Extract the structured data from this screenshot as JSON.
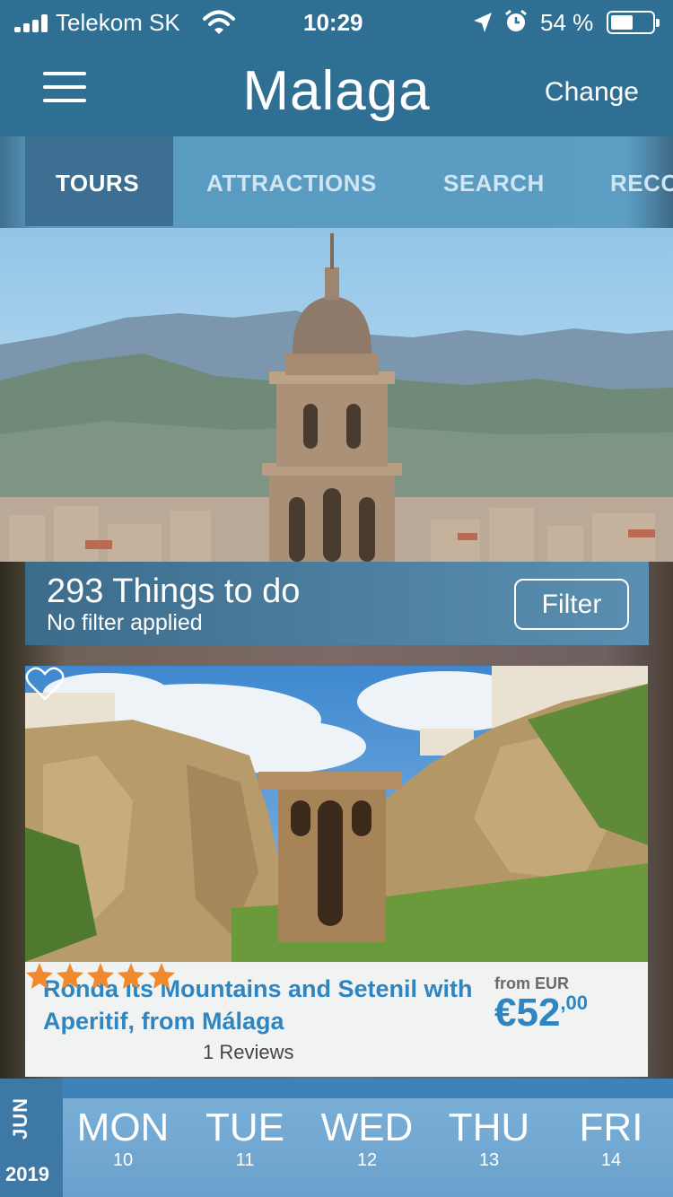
{
  "status_bar": {
    "carrier": "Telekom SK",
    "time": "10:29",
    "battery": "54 %"
  },
  "header": {
    "city": "Malaga",
    "change_label": "Change"
  },
  "tabs": [
    {
      "label": "TOURS",
      "active": true
    },
    {
      "label": "ATTRACTIONS",
      "active": false
    },
    {
      "label": "SEARCH",
      "active": false
    },
    {
      "label": "RECO",
      "active": false
    }
  ],
  "results": {
    "count_text": "293 Things to do",
    "filter_status": "No filter applied",
    "filter_label": "Filter"
  },
  "tour_card": {
    "title": "Ronda its Mountains and Setenil with Aperitif, from Málaga",
    "from_label": "from EUR",
    "price_main": "€52",
    "price_cents": ",00",
    "rating": 5,
    "reviews": "1 Reviews"
  },
  "date_bar": {
    "month": "JUN",
    "year": "2019",
    "days": [
      {
        "name": "MON",
        "date": "10"
      },
      {
        "name": "TUE",
        "date": "11"
      },
      {
        "name": "WED",
        "date": "12"
      },
      {
        "name": "THU",
        "date": "13"
      },
      {
        "name": "FRI",
        "date": "14"
      }
    ]
  },
  "colors": {
    "header_bg": "#2f6f93",
    "accent_text": "#2f85bf",
    "star": "#f08a2c"
  }
}
